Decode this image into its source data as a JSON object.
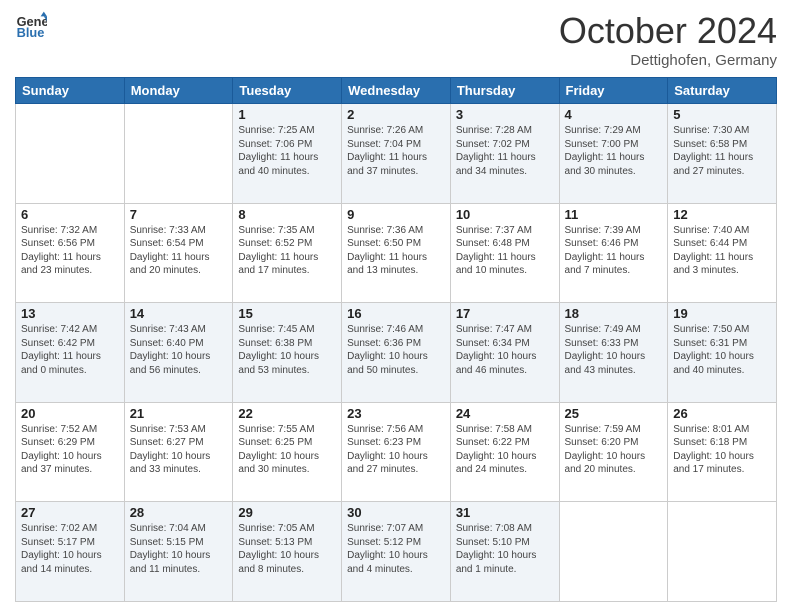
{
  "header": {
    "logo_line1": "General",
    "logo_line2": "Blue",
    "month": "October 2024",
    "location": "Dettighofen, Germany"
  },
  "weekdays": [
    "Sunday",
    "Monday",
    "Tuesday",
    "Wednesday",
    "Thursday",
    "Friday",
    "Saturday"
  ],
  "rows": [
    [
      {
        "day": "",
        "info": ""
      },
      {
        "day": "",
        "info": ""
      },
      {
        "day": "1",
        "info": "Sunrise: 7:25 AM\nSunset: 7:06 PM\nDaylight: 11 hours\nand 40 minutes."
      },
      {
        "day": "2",
        "info": "Sunrise: 7:26 AM\nSunset: 7:04 PM\nDaylight: 11 hours\nand 37 minutes."
      },
      {
        "day": "3",
        "info": "Sunrise: 7:28 AM\nSunset: 7:02 PM\nDaylight: 11 hours\nand 34 minutes."
      },
      {
        "day": "4",
        "info": "Sunrise: 7:29 AM\nSunset: 7:00 PM\nDaylight: 11 hours\nand 30 minutes."
      },
      {
        "day": "5",
        "info": "Sunrise: 7:30 AM\nSunset: 6:58 PM\nDaylight: 11 hours\nand 27 minutes."
      }
    ],
    [
      {
        "day": "6",
        "info": "Sunrise: 7:32 AM\nSunset: 6:56 PM\nDaylight: 11 hours\nand 23 minutes."
      },
      {
        "day": "7",
        "info": "Sunrise: 7:33 AM\nSunset: 6:54 PM\nDaylight: 11 hours\nand 20 minutes."
      },
      {
        "day": "8",
        "info": "Sunrise: 7:35 AM\nSunset: 6:52 PM\nDaylight: 11 hours\nand 17 minutes."
      },
      {
        "day": "9",
        "info": "Sunrise: 7:36 AM\nSunset: 6:50 PM\nDaylight: 11 hours\nand 13 minutes."
      },
      {
        "day": "10",
        "info": "Sunrise: 7:37 AM\nSunset: 6:48 PM\nDaylight: 11 hours\nand 10 minutes."
      },
      {
        "day": "11",
        "info": "Sunrise: 7:39 AM\nSunset: 6:46 PM\nDaylight: 11 hours\nand 7 minutes."
      },
      {
        "day": "12",
        "info": "Sunrise: 7:40 AM\nSunset: 6:44 PM\nDaylight: 11 hours\nand 3 minutes."
      }
    ],
    [
      {
        "day": "13",
        "info": "Sunrise: 7:42 AM\nSunset: 6:42 PM\nDaylight: 11 hours\nand 0 minutes."
      },
      {
        "day": "14",
        "info": "Sunrise: 7:43 AM\nSunset: 6:40 PM\nDaylight: 10 hours\nand 56 minutes."
      },
      {
        "day": "15",
        "info": "Sunrise: 7:45 AM\nSunset: 6:38 PM\nDaylight: 10 hours\nand 53 minutes."
      },
      {
        "day": "16",
        "info": "Sunrise: 7:46 AM\nSunset: 6:36 PM\nDaylight: 10 hours\nand 50 minutes."
      },
      {
        "day": "17",
        "info": "Sunrise: 7:47 AM\nSunset: 6:34 PM\nDaylight: 10 hours\nand 46 minutes."
      },
      {
        "day": "18",
        "info": "Sunrise: 7:49 AM\nSunset: 6:33 PM\nDaylight: 10 hours\nand 43 minutes."
      },
      {
        "day": "19",
        "info": "Sunrise: 7:50 AM\nSunset: 6:31 PM\nDaylight: 10 hours\nand 40 minutes."
      }
    ],
    [
      {
        "day": "20",
        "info": "Sunrise: 7:52 AM\nSunset: 6:29 PM\nDaylight: 10 hours\nand 37 minutes."
      },
      {
        "day": "21",
        "info": "Sunrise: 7:53 AM\nSunset: 6:27 PM\nDaylight: 10 hours\nand 33 minutes."
      },
      {
        "day": "22",
        "info": "Sunrise: 7:55 AM\nSunset: 6:25 PM\nDaylight: 10 hours\nand 30 minutes."
      },
      {
        "day": "23",
        "info": "Sunrise: 7:56 AM\nSunset: 6:23 PM\nDaylight: 10 hours\nand 27 minutes."
      },
      {
        "day": "24",
        "info": "Sunrise: 7:58 AM\nSunset: 6:22 PM\nDaylight: 10 hours\nand 24 minutes."
      },
      {
        "day": "25",
        "info": "Sunrise: 7:59 AM\nSunset: 6:20 PM\nDaylight: 10 hours\nand 20 minutes."
      },
      {
        "day": "26",
        "info": "Sunrise: 8:01 AM\nSunset: 6:18 PM\nDaylight: 10 hours\nand 17 minutes."
      }
    ],
    [
      {
        "day": "27",
        "info": "Sunrise: 7:02 AM\nSunset: 5:17 PM\nDaylight: 10 hours\nand 14 minutes."
      },
      {
        "day": "28",
        "info": "Sunrise: 7:04 AM\nSunset: 5:15 PM\nDaylight: 10 hours\nand 11 minutes."
      },
      {
        "day": "29",
        "info": "Sunrise: 7:05 AM\nSunset: 5:13 PM\nDaylight: 10 hours\nand 8 minutes."
      },
      {
        "day": "30",
        "info": "Sunrise: 7:07 AM\nSunset: 5:12 PM\nDaylight: 10 hours\nand 4 minutes."
      },
      {
        "day": "31",
        "info": "Sunrise: 7:08 AM\nSunset: 5:10 PM\nDaylight: 10 hours\nand 1 minute."
      },
      {
        "day": "",
        "info": ""
      },
      {
        "day": "",
        "info": ""
      }
    ]
  ]
}
